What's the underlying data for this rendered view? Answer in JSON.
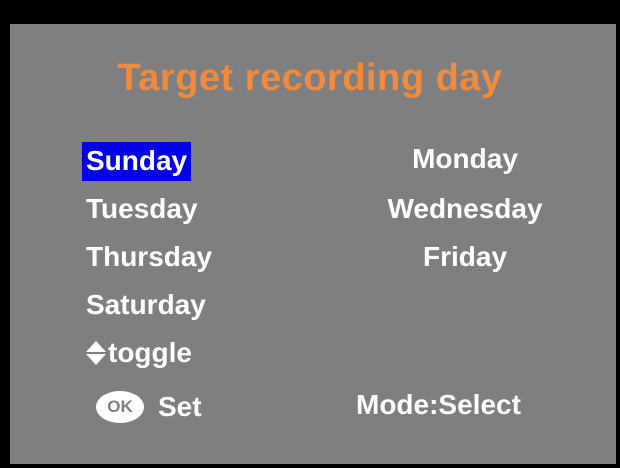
{
  "screen": {
    "title": "Target recording day",
    "selected_day": "Sunday",
    "days": {
      "sunday": "Sunday",
      "monday": "Monday",
      "tuesday": "Tuesday",
      "wednesday": "Wednesday",
      "thursday": "Thursday",
      "friday": "Friday",
      "saturday": "Saturday"
    },
    "hints": {
      "toggle_label": "toggle",
      "ok_icon_text": "OK",
      "set_label": "Set",
      "mode_text": "Mode:Select"
    }
  },
  "icons": {
    "toggle": "up-down-arrows-icon",
    "ok": "ok-button-icon"
  },
  "colors": {
    "background": "#7f7f7f",
    "frame": "#000000",
    "title": "#f08a3c",
    "text": "#ffffff",
    "selection": "#0000e6"
  }
}
